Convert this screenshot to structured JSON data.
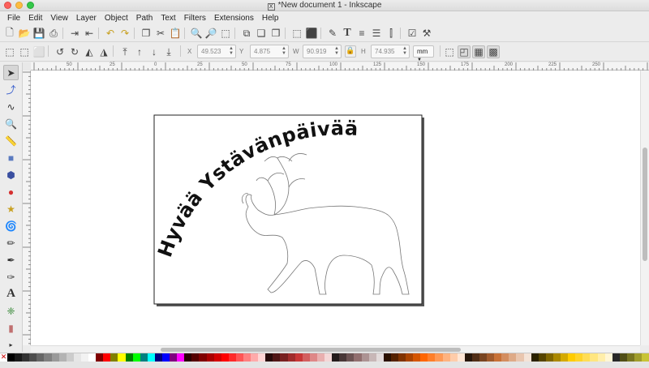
{
  "window": {
    "title": "*New document 1 - Inkscape",
    "x11_glyph": "X"
  },
  "menu": [
    "File",
    "Edit",
    "View",
    "Layer",
    "Object",
    "Path",
    "Text",
    "Filters",
    "Extensions",
    "Help"
  ],
  "command_icons": [
    "new-document-icon",
    "open-icon",
    "save-icon",
    "print-icon",
    "import-icon",
    "export-icon",
    "undo-icon",
    "redo-icon",
    "copy-icon",
    "cut-icon",
    "paste-icon",
    "zoom-selection-icon",
    "zoom-drawing-icon",
    "zoom-page-icon",
    "duplicate-icon",
    "clone-icon",
    "unlink-clone-icon",
    "group-icon",
    "ungroup-icon",
    "fill-stroke-icon",
    "text-font-icon",
    "layers-icon",
    "xml-editor-icon",
    "align-icon",
    "preferences-icon",
    "document-properties-icon"
  ],
  "selector": {
    "x_label": "X",
    "x_value": "49.523",
    "y_label": "Y",
    "y_value": "4.875",
    "w_label": "W",
    "w_value": "90.919",
    "h_label": "H",
    "h_value": "74.935",
    "unit": "mm"
  },
  "ruler_ticks": [
    "50",
    "25",
    "0",
    "25",
    "50",
    "75",
    "100",
    "125",
    "150",
    "175",
    "200",
    "225",
    "250"
  ],
  "canvas": {
    "greeting_text": "Hyvää Ystävänpäivää"
  },
  "palette_colors": [
    "#000000",
    "#1a1a1a",
    "#333333",
    "#4d4d4d",
    "#666666",
    "#808080",
    "#999999",
    "#b3b3b3",
    "#cccccc",
    "#e6e6e6",
    "#f2f2f2",
    "#ffffff",
    "#800000",
    "#ff0000",
    "#808000",
    "#ffff00",
    "#008000",
    "#00ff00",
    "#008080",
    "#00ffff",
    "#000080",
    "#0000ff",
    "#800080",
    "#ff00ff",
    "#2b0000",
    "#550000",
    "#800000",
    "#aa0000",
    "#d40000",
    "#ff0000",
    "#ff2a2a",
    "#ff5555",
    "#ff8080",
    "#ffaaaa",
    "#ffd5d5",
    "#280b0b",
    "#501616",
    "#782121",
    "#a02c2c",
    "#c83737",
    "#d35f5f",
    "#de8787",
    "#e9afaf",
    "#f4d7d7",
    "#241c1c",
    "#483737",
    "#6c5353",
    "#916f6f",
    "#ac9393",
    "#c8b7b7",
    "#e3dbdb",
    "#2b1100",
    "#552200",
    "#803300",
    "#aa4400",
    "#d45500",
    "#ff6600",
    "#ff7f2a",
    "#ff9955",
    "#ffb380",
    "#ffccaa",
    "#ffe6d5",
    "#28170b",
    "#502d16",
    "#784421",
    "#a05a2c",
    "#c87137",
    "#d38d5f",
    "#deaa87",
    "#e9c6af",
    "#f4e3d7",
    "#2b2200",
    "#554400",
    "#806600",
    "#aa8800",
    "#d4aa00",
    "#ffcc00",
    "#ffd42a",
    "#ffdd55",
    "#ffe680",
    "#ffeeaa",
    "#fff6d5",
    "#282828",
    "#504e16",
    "#787521",
    "#a09d2c",
    "#c8c437"
  ]
}
